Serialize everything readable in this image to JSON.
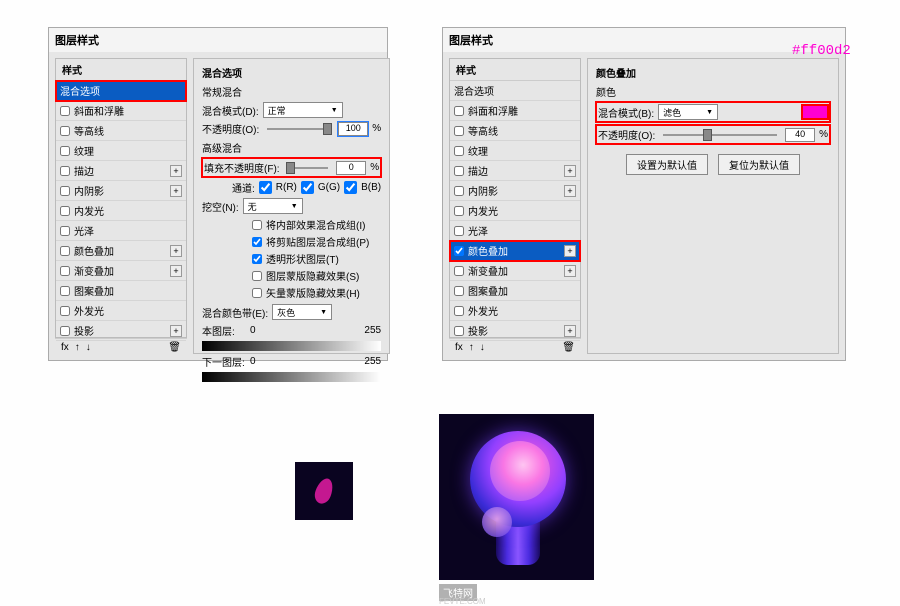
{
  "dialog_title": "图层样式",
  "styles_header": "样式",
  "annotation_color": "#ff00d2",
  "left_panel": {
    "styles": [
      {
        "label": "混合选项",
        "cb": false,
        "plus": false,
        "selected": true
      },
      {
        "label": "斜面和浮雕",
        "cb": true,
        "plus": false
      },
      {
        "label": "等高线",
        "cb": true,
        "plus": false
      },
      {
        "label": "纹理",
        "cb": true,
        "plus": false
      },
      {
        "label": "描边",
        "cb": true,
        "plus": true
      },
      {
        "label": "内阴影",
        "cb": true,
        "plus": true
      },
      {
        "label": "内发光",
        "cb": true,
        "plus": false
      },
      {
        "label": "光泽",
        "cb": true,
        "plus": false
      },
      {
        "label": "颜色叠加",
        "cb": true,
        "plus": true
      },
      {
        "label": "渐变叠加",
        "cb": true,
        "plus": true
      },
      {
        "label": "图案叠加",
        "cb": true,
        "plus": false
      },
      {
        "label": "外发光",
        "cb": true,
        "plus": false
      },
      {
        "label": "投影",
        "cb": true,
        "plus": true
      }
    ],
    "options": {
      "title": "混合选项",
      "section_general": "常规混合",
      "blend_mode_label": "混合模式(D):",
      "blend_mode_value": "正常",
      "opacity_label": "不透明度(O):",
      "opacity_value": "100",
      "section_advanced": "高级混合",
      "fill_opacity_label": "填充不透明度(F):",
      "fill_opacity_value": "0",
      "channels_label": "通道:",
      "ch_r": "R(R)",
      "ch_g": "G(G)",
      "ch_b": "B(B)",
      "knockout_label": "挖空(N):",
      "knockout_value": "无",
      "adv1": "将内部效果混合成组(I)",
      "adv2": "将剪贴图层混合成组(P)",
      "adv3": "透明形状图层(T)",
      "adv4": "图层蒙版隐藏效果(S)",
      "adv5": "矢量蒙版隐藏效果(H)",
      "blendif_label": "混合颜色带(E):",
      "blendif_value": "灰色",
      "this_layer": "本图层:",
      "under_layer": "下一图层:",
      "range_lo": "0",
      "range_hi": "255"
    }
  },
  "right_panel": {
    "styles": [
      {
        "label": "混合选项",
        "cb": false,
        "plus": false
      },
      {
        "label": "斜面和浮雕",
        "cb": true,
        "plus": false
      },
      {
        "label": "等高线",
        "cb": true,
        "plus": false
      },
      {
        "label": "纹理",
        "cb": true,
        "plus": false
      },
      {
        "label": "描边",
        "cb": true,
        "plus": true
      },
      {
        "label": "内阴影",
        "cb": true,
        "plus": true
      },
      {
        "label": "内发光",
        "cb": true,
        "plus": false
      },
      {
        "label": "光泽",
        "cb": true,
        "plus": false
      },
      {
        "label": "颜色叠加",
        "cb": true,
        "checked": true,
        "plus": true,
        "selected": true,
        "red": true
      },
      {
        "label": "渐变叠加",
        "cb": true,
        "plus": true
      },
      {
        "label": "图案叠加",
        "cb": true,
        "plus": false
      },
      {
        "label": "外发光",
        "cb": true,
        "plus": false
      },
      {
        "label": "投影",
        "cb": true,
        "plus": true
      }
    ],
    "options": {
      "title": "颜色叠加",
      "section": "颜色",
      "blend_mode_label": "混合模式(B):",
      "blend_mode_value": "滤色",
      "opacity_label": "不透明度(O):",
      "opacity_value": "40",
      "btn_default": "设置为默认值",
      "btn_reset": "复位为默认值"
    }
  },
  "fx_label": "fx",
  "caption": "飞特网",
  "watermark": "FEVTE.COM",
  "percent": "%"
}
